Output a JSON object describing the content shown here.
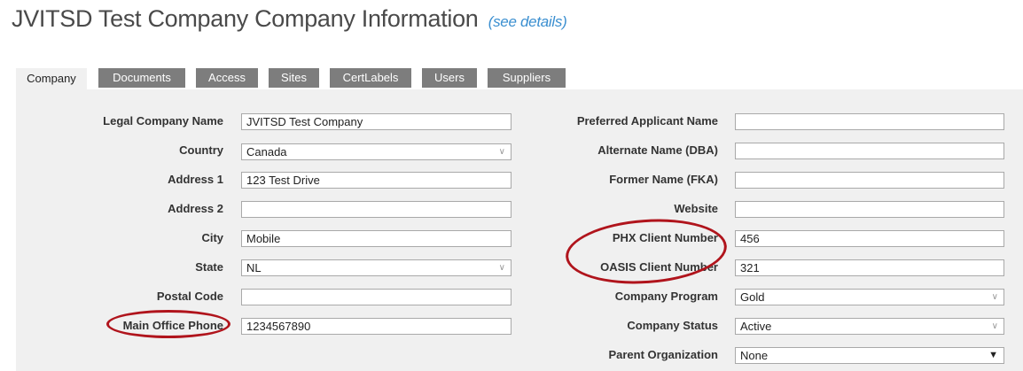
{
  "header": {
    "title": "JVITSD Test Company Company Information",
    "details_link": "(see details)"
  },
  "tabs": [
    {
      "label": "Company",
      "active": true
    },
    {
      "label": "Documents"
    },
    {
      "label": "Access"
    },
    {
      "label": "Sites"
    },
    {
      "label": "CertLabels"
    },
    {
      "label": "Users"
    },
    {
      "label": "Suppliers"
    }
  ],
  "left_fields": {
    "legal_company_name": {
      "label": "Legal Company Name",
      "value": "JVITSD Test Company"
    },
    "country": {
      "label": "Country",
      "value": "Canada"
    },
    "address1": {
      "label": "Address 1",
      "value": "123 Test Drive"
    },
    "address2": {
      "label": "Address 2",
      "value": ""
    },
    "city": {
      "label": "City",
      "value": "Mobile"
    },
    "state": {
      "label": "State",
      "value": "NL"
    },
    "postal_code": {
      "label": "Postal Code",
      "value": ""
    },
    "main_office_phone": {
      "label": "Main Office Phone",
      "value": "1234567890"
    }
  },
  "right_fields": {
    "preferred_applicant_name": {
      "label": "Preferred Applicant Name",
      "value": ""
    },
    "alternate_name": {
      "label": "Alternate Name (DBA)",
      "value": ""
    },
    "former_name": {
      "label": "Former Name (FKA)",
      "value": ""
    },
    "website": {
      "label": "Website",
      "value": ""
    },
    "phx_client_number": {
      "label": "PHX Client Number",
      "value": "456"
    },
    "oasis_client_number": {
      "label": "OASIS Client Number",
      "value": "321"
    },
    "company_program": {
      "label": "Company Program",
      "value": "Gold"
    },
    "company_status": {
      "label": "Company Status",
      "value": "Active"
    },
    "parent_organization": {
      "label": "Parent Organization",
      "value": "None"
    }
  },
  "colors": {
    "tab_bg": "#7d7d7d",
    "panel_bg": "#f0f0f0",
    "annotation": "#b0141c",
    "link": "#3b8fd0"
  }
}
